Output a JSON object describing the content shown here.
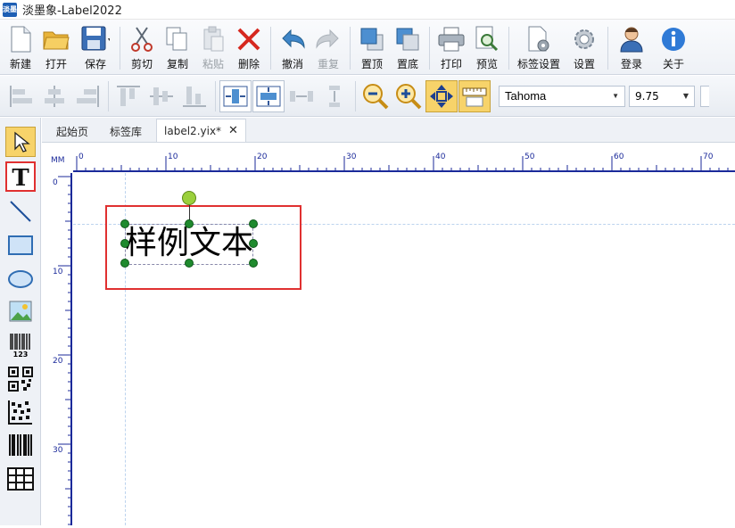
{
  "window": {
    "title": "淡墨象-Label2022",
    "app_icon_text": "淡墨"
  },
  "toolbar": [
    {
      "name": "new-button",
      "label": "新建",
      "icon": "new-file-icon"
    },
    {
      "name": "open-button",
      "label": "打开",
      "icon": "folder-open-icon"
    },
    {
      "name": "save-button",
      "label": "保存",
      "icon": "save-icon"
    },
    {
      "name": "cut-button",
      "label": "剪切",
      "icon": "scissors-icon"
    },
    {
      "name": "copy-button",
      "label": "复制",
      "icon": "copy-icon"
    },
    {
      "name": "paste-button",
      "label": "粘贴",
      "icon": "paste-icon",
      "disabled": true
    },
    {
      "name": "delete-button",
      "label": "删除",
      "icon": "delete-x-icon"
    },
    {
      "name": "undo-button",
      "label": "撤消",
      "icon": "undo-icon"
    },
    {
      "name": "redo-button",
      "label": "重复",
      "icon": "redo-icon",
      "disabled": true
    },
    {
      "name": "bring-front-button",
      "label": "置顶",
      "icon": "bring-to-front-icon"
    },
    {
      "name": "send-back-button",
      "label": "置底",
      "icon": "send-to-back-icon"
    },
    {
      "name": "print-button",
      "label": "打印",
      "icon": "printer-icon"
    },
    {
      "name": "preview-button",
      "label": "预览",
      "icon": "preview-magnifier-icon"
    },
    {
      "name": "label-settings-button",
      "label": "标签设置",
      "icon": "label-settings-icon"
    },
    {
      "name": "settings-button",
      "label": "设置",
      "icon": "gear-icon"
    },
    {
      "name": "login-button",
      "label": "登录",
      "icon": "user-icon"
    },
    {
      "name": "about-button",
      "label": "关于",
      "icon": "info-icon"
    }
  ],
  "format_bar": {
    "font": "Tahoma",
    "size": "9.75"
  },
  "tabs": [
    {
      "name": "tab-home",
      "label": "起始页"
    },
    {
      "name": "tab-library",
      "label": "标签库"
    },
    {
      "name": "tab-document",
      "label": "label2.yix*",
      "active": true
    }
  ],
  "ruler": {
    "unit": "MM",
    "h_labels": [
      "0",
      "10",
      "20",
      "30",
      "40",
      "50",
      "60",
      "70"
    ],
    "v_labels": [
      "0",
      "10",
      "20",
      "30"
    ]
  },
  "canvas": {
    "sample_text": "样例文本"
  },
  "colors": {
    "accent_yellow": "#f7d36a",
    "highlight_red": "#e03030",
    "ruler_blue": "#1b2a9a",
    "handle_green": "#1f8a2e"
  }
}
